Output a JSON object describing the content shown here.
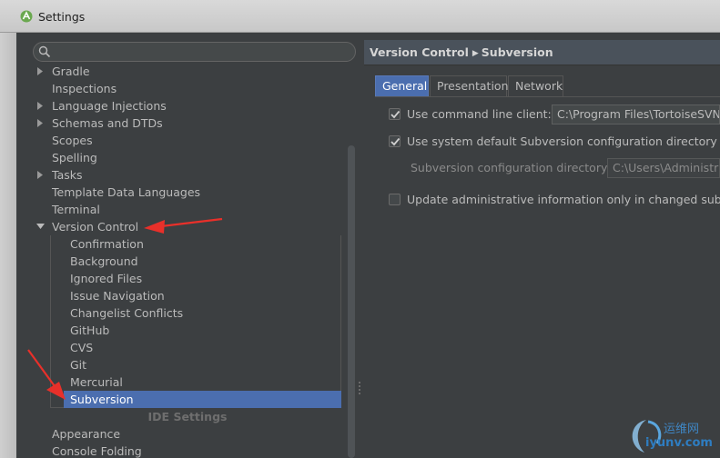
{
  "window": {
    "title": "Settings"
  },
  "search": {
    "placeholder": ""
  },
  "tree": {
    "items": [
      {
        "label": "Gradle",
        "expandable": true
      },
      {
        "label": "Inspections",
        "expandable": false
      },
      {
        "label": "Language Injections",
        "expandable": true
      },
      {
        "label": "Schemas and DTDs",
        "expandable": true
      },
      {
        "label": "Scopes",
        "expandable": false
      },
      {
        "label": "Spelling",
        "expandable": false
      },
      {
        "label": "Tasks",
        "expandable": true
      },
      {
        "label": "Template Data Languages",
        "expandable": false
      },
      {
        "label": "Terminal",
        "expandable": false
      },
      {
        "label": "Version Control",
        "expandable": true,
        "expanded": true
      }
    ],
    "version_control_children": [
      {
        "label": "Confirmation"
      },
      {
        "label": "Background"
      },
      {
        "label": "Ignored Files"
      },
      {
        "label": "Issue Navigation"
      },
      {
        "label": "Changelist Conflicts"
      },
      {
        "label": "GitHub"
      },
      {
        "label": "CVS"
      },
      {
        "label": "Git"
      },
      {
        "label": "Mercurial"
      },
      {
        "label": "Subversion",
        "selected": true
      }
    ],
    "ide_section_label": "IDE Settings",
    "ide_items": [
      {
        "label": "Appearance"
      },
      {
        "label": "Console Folding"
      }
    ]
  },
  "breadcrumb": {
    "parent": "Version Control",
    "current": "Subversion"
  },
  "tabs": [
    {
      "label": "General",
      "active": true
    },
    {
      "label": "Presentation",
      "active": false
    },
    {
      "label": "Network",
      "active": false
    }
  ],
  "general": {
    "use_command_line_client": {
      "label": "Use command line client:",
      "checked": true,
      "value": "C:\\Program Files\\TortoiseSVN\\"
    },
    "use_system_default_config": {
      "label": "Use system default Subversion configuration directory",
      "checked": true
    },
    "config_directory": {
      "label": "Subversion configuration directory:",
      "value": "C:\\Users\\Administrat"
    },
    "update_admin_info": {
      "label": "Update administrative information only in changed subtree",
      "checked": false
    }
  },
  "watermark": {
    "cn": "运维网",
    "url": "iyunv.com"
  },
  "colors": {
    "selection": "#4b6eaf",
    "panel": "#3c3f41",
    "annotation_arrow": "#e8302a"
  }
}
